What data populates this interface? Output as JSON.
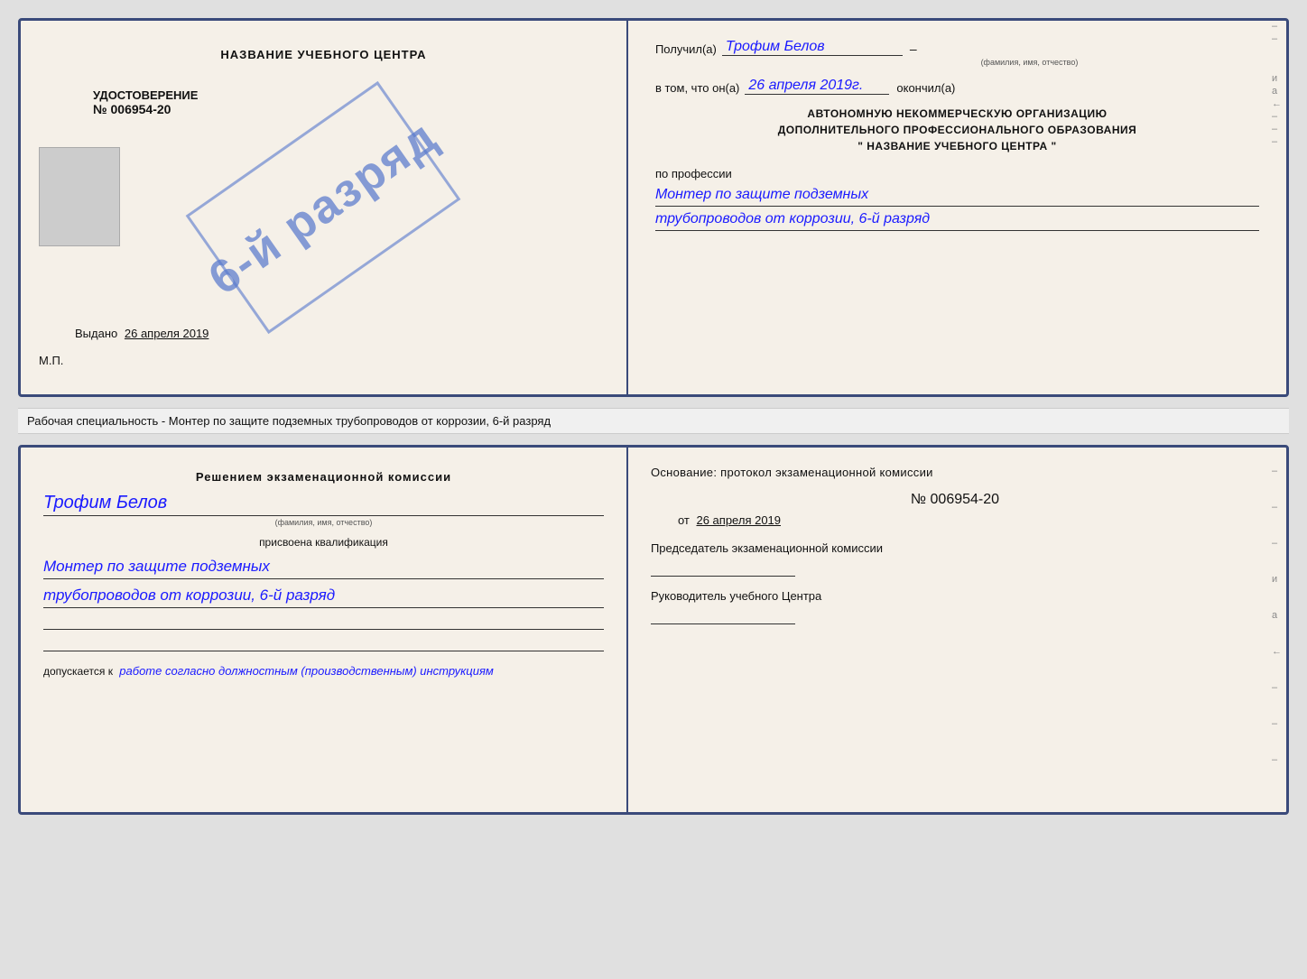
{
  "page": {
    "background": "#e0e0e0"
  },
  "top_doc": {
    "left": {
      "title": "НАЗВАНИЕ УЧЕБНОГО ЦЕНТРА",
      "stamp_text": "6-й разряд",
      "cert_label": "УДОСТОВЕРЕНИЕ",
      "cert_number": "№ 006954-20",
      "issued_label": "Выдано",
      "issued_date": "26 апреля 2019",
      "mp_label": "М.П."
    },
    "right": {
      "received_label": "Получил(а)",
      "received_name": "Трофим Белов",
      "received_sub": "(фамилия, имя, отчество)",
      "dash1": "–",
      "in_that_label": "в том, что он(а)",
      "date_value": "26 апреля 2019г.",
      "finished_label": "окончил(а)",
      "org_line1": "АВТОНОМНУЮ НЕКОММЕРЧЕСКУЮ ОРГАНИЗАЦИЮ",
      "org_line2": "ДОПОЛНИТЕЛЬНОГО ПРОФЕССИОНАЛЬНОГО ОБРАЗОВАНИЯ",
      "org_line3": "\"   НАЗВАНИЕ УЧЕБНОГО ЦЕНТРА   \"",
      "profession_label": "по профессии",
      "profession_line1": "Монтер по защите подземных",
      "profession_line2": "трубопроводов от коррозии, 6-й разряд",
      "side_labels": [
        "–",
        "–",
        "и",
        "а",
        "←",
        "–",
        "–",
        "–"
      ]
    }
  },
  "caption": {
    "text": "Рабочая специальность - Монтер по защите подземных трубопроводов от коррозии, 6-й разряд"
  },
  "bottom_doc": {
    "left": {
      "title": "Решением экзаменационной комиссии",
      "name": "Трофим Белов",
      "name_sub": "(фамилия, имя, отчество)",
      "assigned_label": "присвоена квалификация",
      "qualification_line1": "Монтер по защите подземных",
      "qualification_line2": "трубопроводов от коррозии, 6-й разряд",
      "допускается_label": "допускается к",
      "допускается_value": "работе согласно должностным (производственным) инструкциям"
    },
    "right": {
      "osnov_label": "Основание: протокол экзаменационной комиссии",
      "number": "№ 006954-20",
      "date_prefix": "от",
      "date_value": "26 апреля 2019",
      "chair_label": "Председатель экзаменационной комиссии",
      "head_label": "Руководитель учебного Центра",
      "side_labels": [
        "–",
        "–",
        "–",
        "и",
        "а",
        "←",
        "–",
        "–",
        "–"
      ]
    }
  }
}
